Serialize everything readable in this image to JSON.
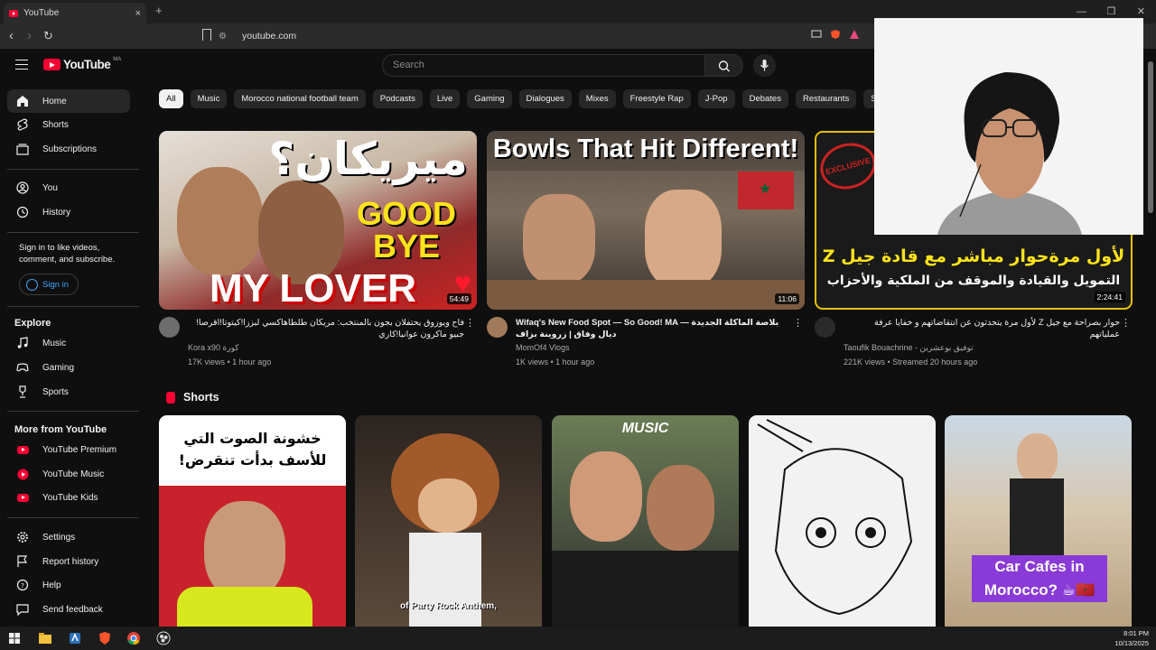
{
  "browser": {
    "tab_title": "YouTube",
    "url": "youtube.com",
    "new_tab": "+",
    "close": "×",
    "window_controls": [
      "—",
      "❐",
      "✕"
    ]
  },
  "header": {
    "logo_text": "YouTube",
    "country_code": "MA",
    "search_placeholder": "Search"
  },
  "sidebar": {
    "main": [
      {
        "label": "Home",
        "icon": "home-icon"
      },
      {
        "label": "Shorts",
        "icon": "shorts-icon"
      },
      {
        "label": "Subscriptions",
        "icon": "subscriptions-icon"
      }
    ],
    "you": [
      {
        "label": "You",
        "icon": "user-icon"
      },
      {
        "label": "History",
        "icon": "history-icon"
      }
    ],
    "signin_prompt": "Sign in to like videos, comment, and subscribe.",
    "signin_button": "Sign in",
    "explore_heading": "Explore",
    "explore": [
      {
        "label": "Music",
        "icon": "music-icon"
      },
      {
        "label": "Gaming",
        "icon": "gaming-icon"
      },
      {
        "label": "Sports",
        "icon": "trophy-icon"
      }
    ],
    "more_heading": "More from YouTube",
    "more": [
      {
        "label": "YouTube Premium"
      },
      {
        "label": "YouTube Music"
      },
      {
        "label": "YouTube Kids"
      }
    ],
    "footer": [
      {
        "label": "Settings",
        "icon": "gear-icon"
      },
      {
        "label": "Report history",
        "icon": "flag-icon"
      },
      {
        "label": "Help",
        "icon": "help-icon"
      },
      {
        "label": "Send feedback",
        "icon": "feedback-icon"
      }
    ]
  },
  "chips": [
    "All",
    "Music",
    "Morocco national football team",
    "Podcasts",
    "Live",
    "Gaming",
    "Dialogues",
    "Mixes",
    "Freestyle Rap",
    "J-Pop",
    "Debates",
    "Restaurants",
    "St"
  ],
  "videos": [
    {
      "thumb_text_top": "ميريكان؟",
      "thumb_text_mid": "GOOD BYE",
      "thumb_text_bottom": "MY LOVER",
      "duration": "54:49",
      "title": "فاح ويوزوق يحتفلان بجون بالمنتخب: مريكان طلطاهاكسي لبززا!كيتوتا!اقرصا!جبيو ماكرون عوانيا!كاري",
      "channel": "Kora x90 كورة",
      "stats": "17K views • 1 hour ago"
    },
    {
      "thumb_text_top": "Bowls That Hit Different!",
      "duration": "11:06",
      "title": "Wifaq's New Food Spot — So Good! MA — بلاصة الماكلة الجديدة ديال وفاق | زروينة بزاف",
      "channel": "MomOf4 Vlogs",
      "stats": "1K views • 1 hour ago"
    },
    {
      "thumb_badge": "EXCLUSIVE",
      "thumb_text_top": "لأول مرةحوار مباشر مع قادة جيل Z",
      "thumb_text_bottom": "التمويل والقيادة والموقف من الملكية والأحزاب",
      "duration": "2:24:41",
      "title": "حوار بصراحة مع جيل Z لأول مرة يتحدثون عن انتقاضاتهم و خفايا عرفة عملياتهم",
      "channel": "Taoufik Bouachrine - توفيق بوعشرين",
      "stats": "221K views • Streamed 20 hours ago"
    }
  ],
  "shorts": {
    "heading": "Shorts",
    "items": [
      {
        "caption": "خشونة الصوت التي للأسف بدأت تنقرض!"
      },
      {
        "caption": "of Party Rock Anthem,"
      },
      {
        "caption": "MUSIC"
      },
      {
        "caption": ""
      },
      {
        "caption": "Car Cafes in Morocco? ☕🇲🇦"
      }
    ]
  },
  "taskbar": {
    "time": "8:01 PM",
    "date": "10/13/2025"
  },
  "colors": {
    "background": "#0f0f0f",
    "accent_red": "#ff0033",
    "link_blue": "#3ea6ff",
    "chip_bg": "#272727"
  }
}
